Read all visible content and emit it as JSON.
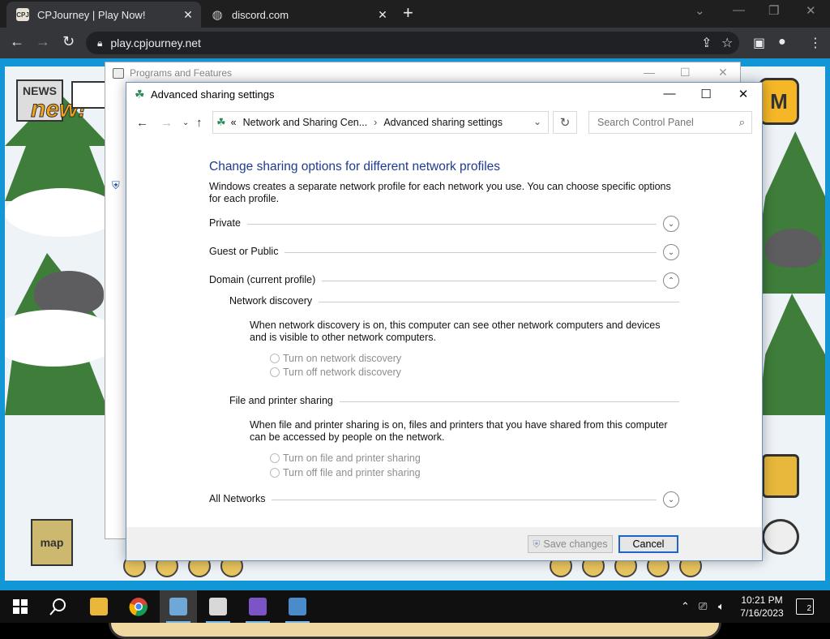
{
  "browser": {
    "tabs": [
      {
        "title": "CPJourney | Play Now!",
        "favicon": "cpj-favicon",
        "active": true
      },
      {
        "title": "discord.com",
        "favicon": "globe-icon",
        "active": false
      }
    ],
    "url": "play.cpjourney.net",
    "icons": [
      "back-icon",
      "forward-icon",
      "reload-icon",
      "lock-icon",
      "share-icon",
      "star-icon",
      "sidepanel-icon",
      "profile-icon",
      "menu-icon"
    ]
  },
  "game": {
    "news_label": "NEWS",
    "new_badge": "new!",
    "moderator_badge": "M",
    "map_label": "map"
  },
  "background_window": {
    "title": "Programs and Features"
  },
  "dialog": {
    "title": "Advanced sharing settings",
    "breadcrumb": {
      "overflow": "«",
      "items": [
        "Network and Sharing Cen...",
        "Advanced sharing settings"
      ]
    },
    "search_placeholder": "Search Control Panel",
    "heading": "Change sharing options for different network profiles",
    "intro": "Windows creates a separate network profile for each network you use. You can choose specific options for each profile.",
    "profiles": [
      {
        "label": "Private",
        "expanded": false
      },
      {
        "label": "Guest or Public",
        "expanded": false
      },
      {
        "label": "Domain (current profile)",
        "expanded": true
      },
      {
        "label": "All Networks",
        "expanded": false
      }
    ],
    "network_discovery": {
      "title": "Network discovery",
      "description": "When network discovery is on, this computer can see other network computers and devices and is visible to other network computers.",
      "options": [
        "Turn on network discovery",
        "Turn off network discovery"
      ]
    },
    "file_sharing": {
      "title": "File and printer sharing",
      "description": "When file and printer sharing is on, files and printers that you have shared from this computer can be accessed by people on the network.",
      "options": [
        "Turn on file and printer sharing",
        "Turn off file and printer sharing"
      ]
    },
    "buttons": {
      "save": "Save changes",
      "cancel": "Cancel"
    }
  },
  "taskbar": {
    "apps": [
      "start-icon",
      "search-icon",
      "file-explorer-icon",
      "chrome-icon",
      "control-panel-icon",
      "notepad-icon",
      "visual-studio-icon",
      "remote-desktop-icon"
    ],
    "time": "10:21 PM",
    "date": "7/16/2023",
    "notification_count": "2"
  },
  "colors": {
    "heading": "#1e3c8e",
    "game_frame": "#1296d6",
    "focus_border": "#1e65c8"
  }
}
